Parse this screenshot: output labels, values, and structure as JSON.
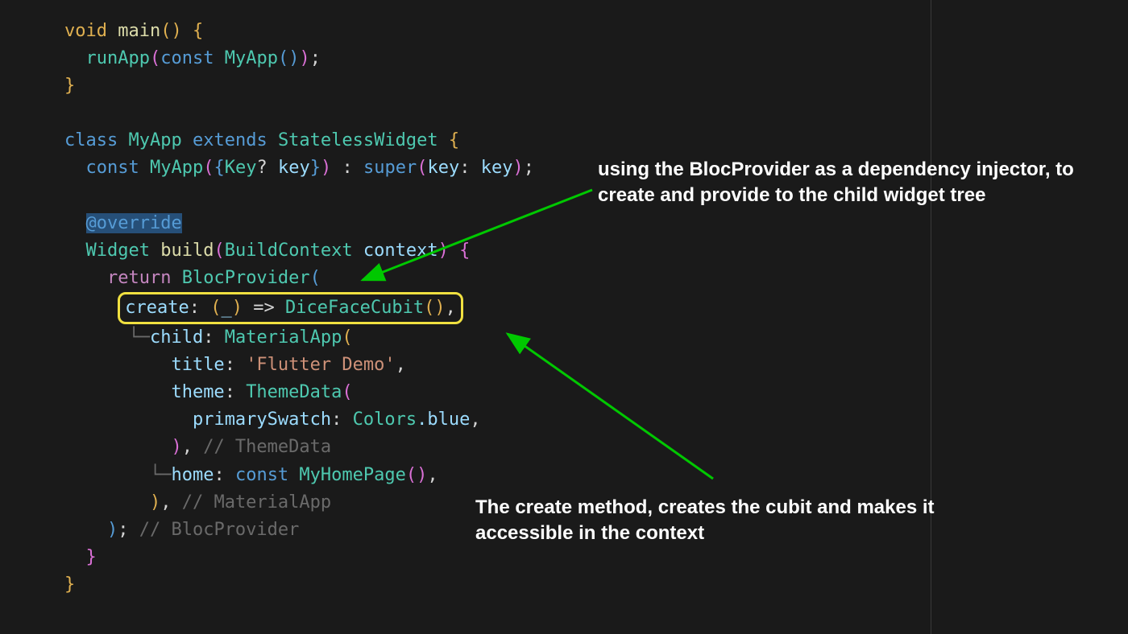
{
  "code": {
    "l1_void": "void",
    "l1_main": "main",
    "l1_rest": "() {",
    "l2_run": "runApp",
    "l2_const": "const",
    "l2_myapp": "MyApp",
    "l2_end": "());",
    "l3_brace": "}",
    "l5_class": "class",
    "l5_myapp": "MyApp",
    "l5_extends": "extends",
    "l5_sw": "StatelessWidget",
    "l5_open": " {",
    "l6_const": "const",
    "l6_myapp": "MyApp",
    "l6_key1": "{Key",
    "l6_q": "?",
    "l6_key2": " key}",
    "l6_colon": " : ",
    "l6_super": "super",
    "l6_keyarg": "key: key",
    "l6_end": ";",
    "l8_override": "@override",
    "l9_widget": "Widget",
    "l9_build": "build",
    "l9_bctx": "BuildContext",
    "l9_ctx": " context",
    "l9_open": " {",
    "l10_return": "return",
    "l10_bp": "BlocProvider",
    "l10_open": "(",
    "l11_create": "create: ",
    "l11_arrow": "(_) => ",
    "l11_cubit": "DiceFaceCubit",
    "l11_end": "(),",
    "l12_tree": "└─",
    "l12_child": "child: ",
    "l12_mapp": "MaterialApp",
    "l12_open": "(",
    "l13_title": "title: ",
    "l13_val": "'Flutter Demo'",
    "l13_comma": ",",
    "l14_theme": "theme: ",
    "l14_td": "ThemeData",
    "l14_open": "(",
    "l15_ps": "primarySwatch: ",
    "l15_colors": "Colors",
    "l15_blue": ".blue",
    "l15_comma": ",",
    "l16_close": ")",
    "l16_comma": ",",
    "l16_comment": " // ThemeData",
    "l17_tree": "└─",
    "l17_home": "home: ",
    "l17_const": "const",
    "l17_mhp": " MyHomePage",
    "l17_end": "(),",
    "l18_close": ")",
    "l18_comma": ",",
    "l18_comment": " // MaterialApp",
    "l19_close": ")",
    "l19_semi": ";",
    "l19_comment": " // BlocProvider",
    "l20_brace": "}",
    "l21_brace": "}"
  },
  "annotations": {
    "a1": "using the BlocProvider as a dependency injector, to create and provide to the child widget tree",
    "a2": "The create method, creates the cubit and makes it accessible in the context"
  },
  "colors": {
    "highlight": "#f0e040",
    "arrow": "#00c800"
  }
}
